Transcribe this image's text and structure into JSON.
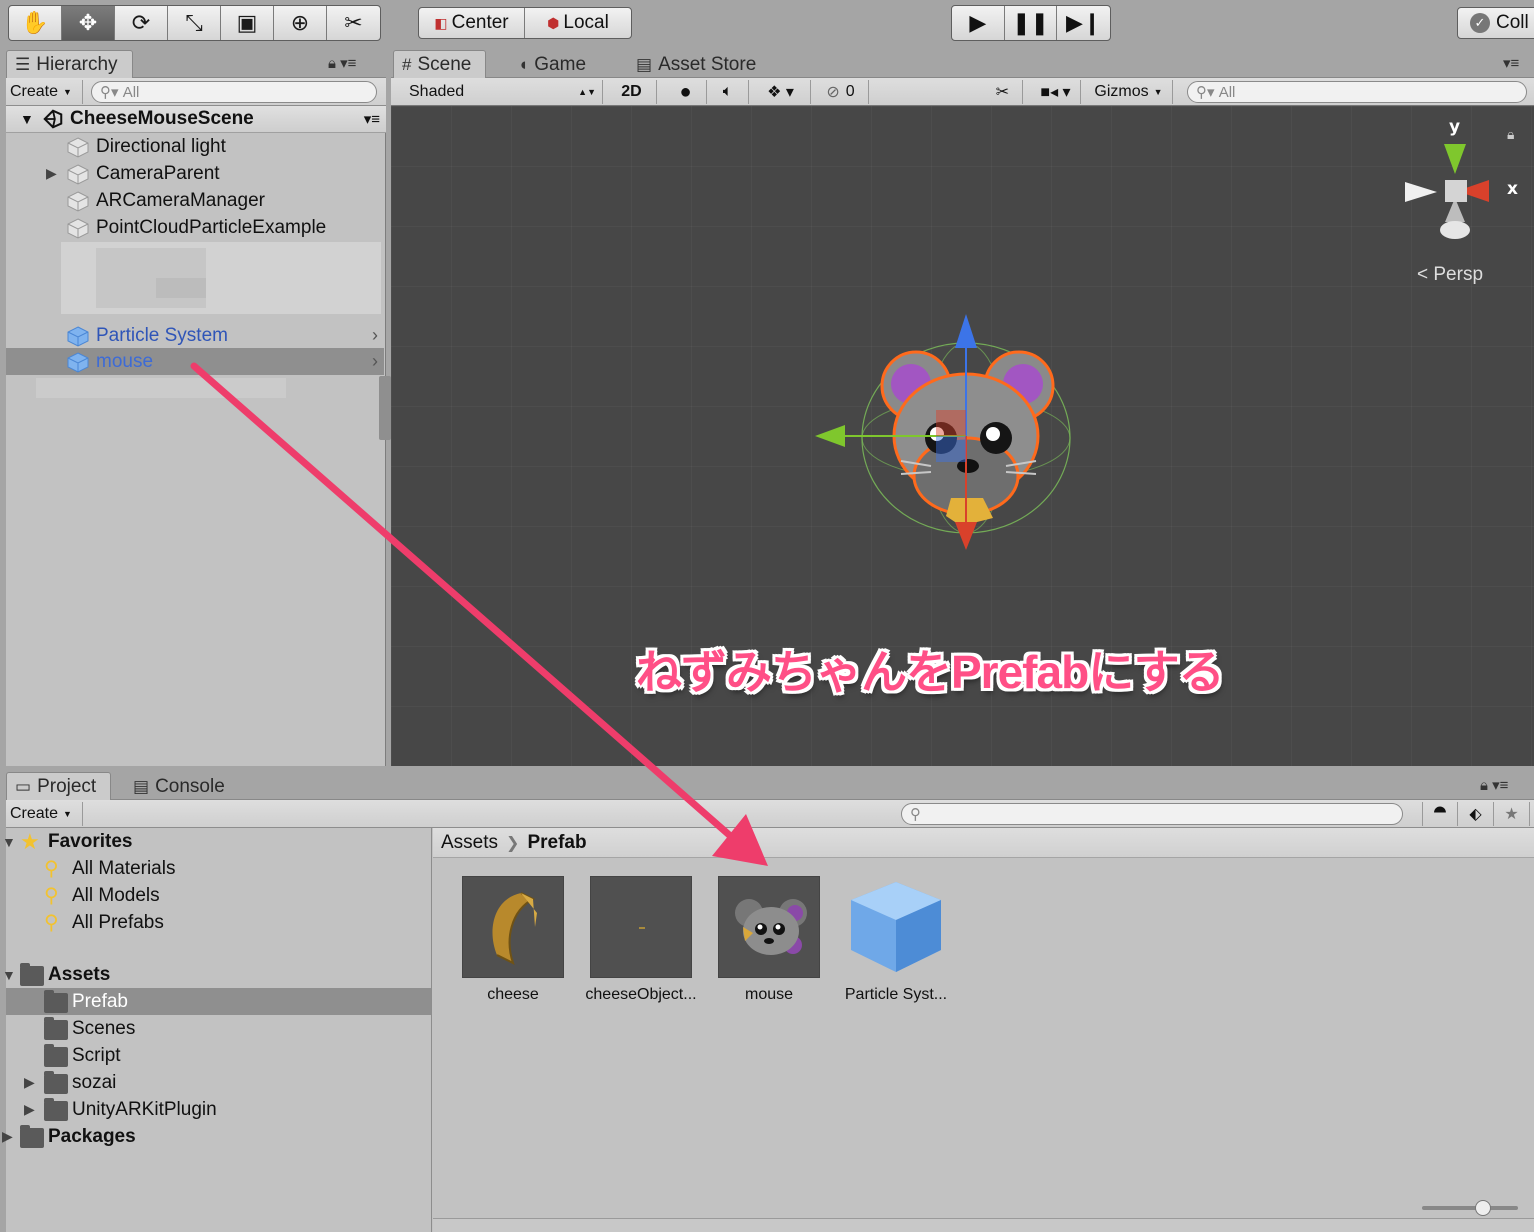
{
  "toolbar": {
    "tools": [
      {
        "icon": "hand-icon",
        "glyph": "✋"
      },
      {
        "icon": "move-icon",
        "glyph": "✥"
      },
      {
        "icon": "rotate-icon",
        "glyph": "⟳"
      },
      {
        "icon": "scale-icon",
        "glyph": "⤡"
      },
      {
        "icon": "rect-icon",
        "glyph": "▣"
      },
      {
        "icon": "transform-icon",
        "glyph": "⊕"
      },
      {
        "icon": "custom-tool-icon",
        "glyph": "✂"
      }
    ],
    "pivot_mode": "Center",
    "pivot_rotation": "Local",
    "collab_label": "Coll"
  },
  "hierarchy": {
    "tab_label": "Hierarchy",
    "create_label": "Create",
    "search_placeholder": "All",
    "scene_name": "CheeseMouseScene",
    "items": [
      {
        "label": "Directional light"
      },
      {
        "label": "CameraParent"
      },
      {
        "label": "ARCameraManager"
      },
      {
        "label": "PointCloudParticleExample"
      },
      {
        "label": "Particle System"
      },
      {
        "label": "mouse"
      }
    ]
  },
  "scene": {
    "tabs": [
      {
        "label": "Scene",
        "icon": "grid-icon"
      },
      {
        "label": "Game",
        "icon": "pacman-icon"
      },
      {
        "label": "Asset Store",
        "icon": "store-icon"
      }
    ],
    "shading_mode": "Shaded",
    "mode_2d": "2D",
    "hidden_count": "0",
    "gizmos_label": "Gizmos",
    "search_placeholder": "All",
    "axis_y": "y",
    "axis_x": "x",
    "projection_label": "Persp",
    "overlay_caption": "ねずみちゃんをPrefabにする",
    "colors": {
      "caption": "#ff4f86",
      "arrow": "#ee3d6b",
      "axis_x": "#d9412b",
      "axis_y": "#7fc72d",
      "axis_z": "#3c74e8"
    }
  },
  "project": {
    "tabs": [
      {
        "label": "Project",
        "icon": "folder-icon"
      },
      {
        "label": "Console",
        "icon": "console-icon"
      }
    ],
    "create_label": "Create",
    "favorites": {
      "label": "Favorites",
      "items": [
        {
          "label": "All Materials"
        },
        {
          "label": "All Models"
        },
        {
          "label": "All Prefabs"
        }
      ]
    },
    "assets_label": "Assets",
    "folders": [
      {
        "label": "Prefab"
      },
      {
        "label": "Scenes"
      },
      {
        "label": "Script"
      },
      {
        "label": "sozai"
      },
      {
        "label": "UnityARKitPlugin"
      }
    ],
    "packages_label": "Packages",
    "breadcrumb": {
      "root": "Assets",
      "current": "Prefab"
    },
    "assets": [
      {
        "label": "cheese"
      },
      {
        "label": "cheeseObject..."
      },
      {
        "label": "mouse"
      },
      {
        "label": "Particle Syst..."
      }
    ]
  }
}
